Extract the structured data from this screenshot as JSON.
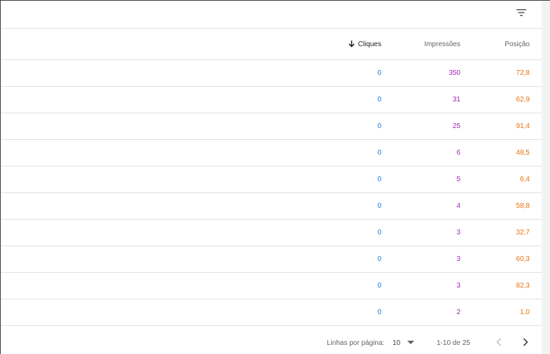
{
  "table": {
    "columns": {
      "clicks": "Cliques",
      "impressions": "Impressões",
      "position": "Posição"
    },
    "sort": {
      "column": "clicks",
      "direction": "descending",
      "icon": "arrow-down-icon"
    },
    "rows": [
      {
        "clicks": "0",
        "impressions": "350",
        "position": "72,8"
      },
      {
        "clicks": "0",
        "impressions": "31",
        "position": "62,9"
      },
      {
        "clicks": "0",
        "impressions": "25",
        "position": "91,4"
      },
      {
        "clicks": "0",
        "impressions": "6",
        "position": "48,5"
      },
      {
        "clicks": "0",
        "impressions": "5",
        "position": "6,4"
      },
      {
        "clicks": "0",
        "impressions": "4",
        "position": "58,8"
      },
      {
        "clicks": "0",
        "impressions": "3",
        "position": "32,7"
      },
      {
        "clicks": "0",
        "impressions": "3",
        "position": "60,3"
      },
      {
        "clicks": "0",
        "impressions": "3",
        "position": "82,3"
      },
      {
        "clicks": "0",
        "impressions": "2",
        "position": "1,0"
      }
    ]
  },
  "toolbar": {
    "filter_icon": "filter-icon"
  },
  "footer": {
    "rows_per_page_label": "Linhas por página:",
    "rows_per_page_value": "10",
    "range": "1-10 de 25",
    "prev_icon": "chevron-left-icon",
    "next_icon": "chevron-right-icon"
  },
  "colors": {
    "clicks": "#1a73e8",
    "impressions": "#9c27b0",
    "position": "#e8710a",
    "border": "#e0e0e0"
  }
}
